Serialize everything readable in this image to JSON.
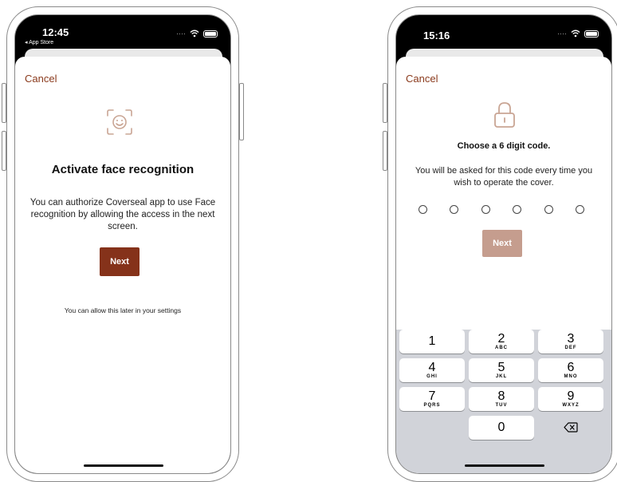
{
  "left_phone": {
    "status": {
      "time": "12:45",
      "back_label": "◂ App Store"
    },
    "cancel_label": "Cancel",
    "title": "Activate face recognition",
    "description": "You can authorize Coverseal app to use Face recognition by allowing the access in the next screen.",
    "next_label": "Next",
    "footnote": "You can allow this later in your settings"
  },
  "right_phone": {
    "status": {
      "time": "15:16"
    },
    "cancel_label": "Cancel",
    "title": "Choose a 6 digit code.",
    "description": "You will be asked for this code every time you wish to operate the cover.",
    "next_label": "Next",
    "code_length": 6,
    "keypad": [
      {
        "num": "1",
        "letters": ""
      },
      {
        "num": "2",
        "letters": "ABC"
      },
      {
        "num": "3",
        "letters": "DEF"
      },
      {
        "num": "4",
        "letters": "GHI"
      },
      {
        "num": "5",
        "letters": "JKL"
      },
      {
        "num": "6",
        "letters": "MNO"
      },
      {
        "num": "7",
        "letters": "PQRS"
      },
      {
        "num": "8",
        "letters": "TUV"
      },
      {
        "num": "9",
        "letters": "WXYZ"
      },
      {
        "num": "0",
        "letters": ""
      }
    ]
  },
  "colors": {
    "accent": "#85321a",
    "accent_disabled": "#c59d8e",
    "icon": "#c9a594",
    "keypad_bg": "#d1d3d9"
  },
  "icons": [
    "face-id-icon",
    "lock-icon",
    "wifi-icon",
    "battery-icon",
    "backspace-icon"
  ]
}
